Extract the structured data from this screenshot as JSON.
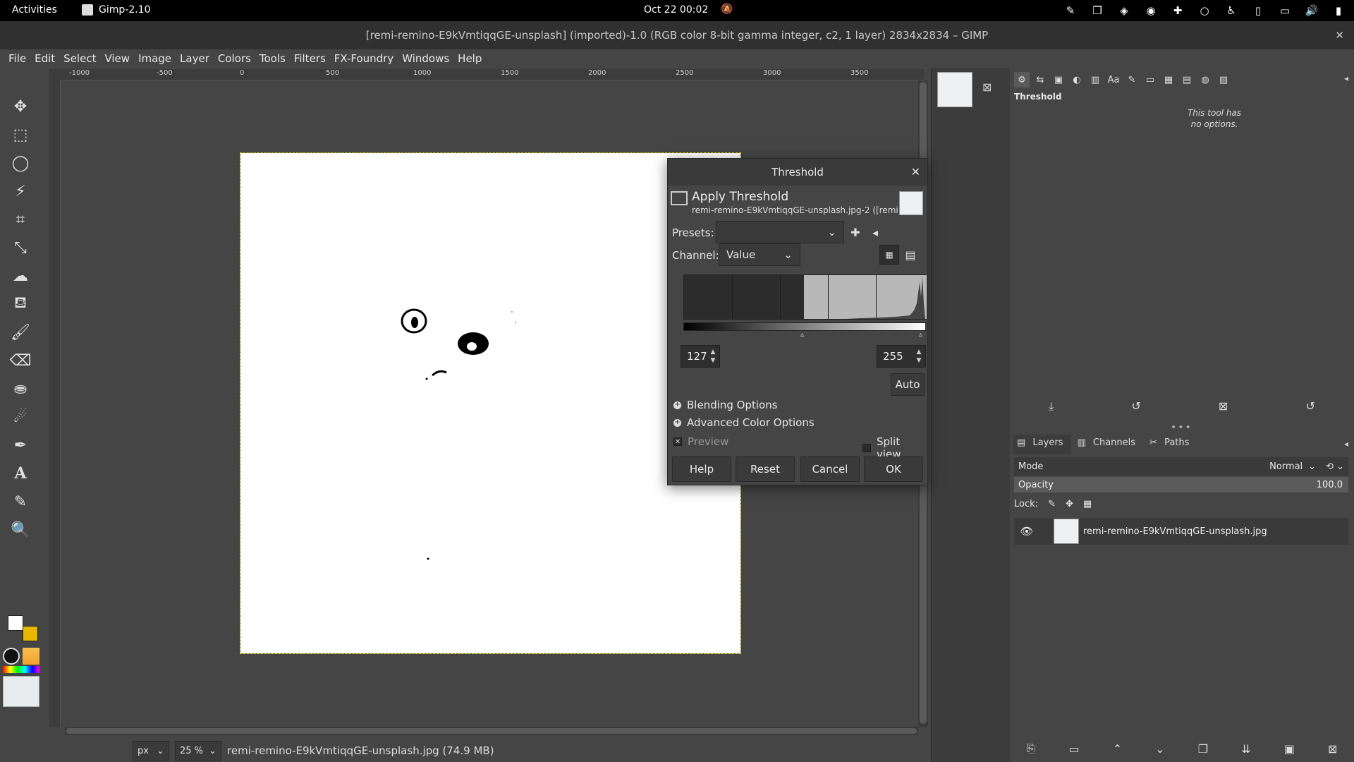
{
  "topbar": {
    "activities": "Activities",
    "app_name": "Gimp-2.10",
    "clock": "Oct 22  00:02"
  },
  "titlebar": {
    "title": "[remi-remino-E9kVmtiqqGE-unsplash] (imported)-1.0 (RGB color 8-bit gamma integer, c2, 1 layer) 2834x2834 – GIMP"
  },
  "menubar": [
    "File",
    "Edit",
    "Select",
    "View",
    "Image",
    "Layer",
    "Colors",
    "Tools",
    "Filters",
    "FX-Foundry",
    "Windows",
    "Help"
  ],
  "ruler": {
    "labels": [
      "-1000",
      "-500",
      "0",
      "500",
      "1000",
      "1500",
      "2000",
      "2500",
      "3000",
      "3500"
    ]
  },
  "statusbar": {
    "unit": "px",
    "zoom": "25 %",
    "file_info": "remi-remino-E9kVmtiqqGE-unsplash.jpg (74.9 MB)"
  },
  "threshold_dialog": {
    "window_title": "Threshold",
    "heading": "Apply Threshold",
    "subheading": "remi-remino-E9kVmtiqqGE-unsplash.jpg-2 ([remi...",
    "presets_label": "Presets:",
    "presets_value": "",
    "channel_label": "Channel:",
    "channel_value": "Value",
    "low_value": "127",
    "high_value": "255",
    "auto_label": "Auto",
    "blending_options": "Blending Options",
    "advanced_color_options": "Advanced Color Options",
    "preview_label": "Preview",
    "split_view_label": "Split view",
    "buttons": {
      "help": "Help",
      "reset": "Reset",
      "cancel": "Cancel",
      "ok": "OK"
    }
  },
  "tool_options": {
    "title": "Threshold",
    "message_line1": "This tool has",
    "message_line2": "no options."
  },
  "layers_panel": {
    "tabs": [
      "Layers",
      "Channels",
      "Paths"
    ],
    "mode_label": "Mode",
    "mode_value": "Normal",
    "opacity_label": "Opacity",
    "opacity_value": "100.0",
    "lock_label": "Lock:",
    "layers": [
      {
        "name": "remi-remino-E9kVmtiqqGE-unsplash.jpg",
        "visible": true
      }
    ]
  }
}
